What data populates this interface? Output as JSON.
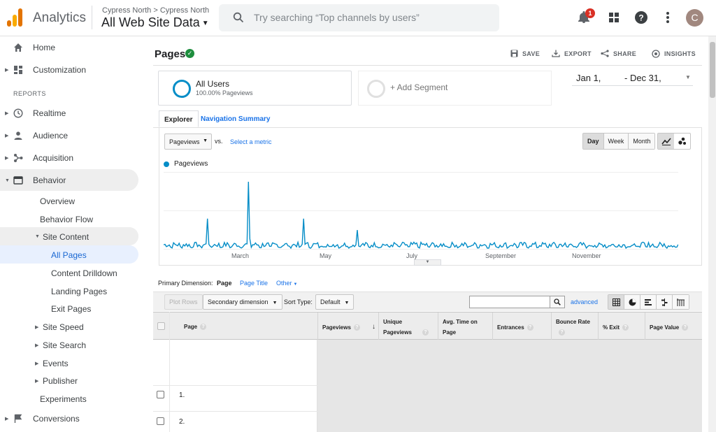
{
  "app": {
    "name": "Analytics",
    "account_path": "Cypress North > Cypress North",
    "view": "All Web Site Data",
    "search_placeholder": "Try searching “Top channels by users”",
    "notification_count": "1",
    "avatar_initial": "C",
    "brand_colors": {
      "orange_dark": "#e37400",
      "orange_light": "#f9ab00",
      "accent": "#058dc7"
    }
  },
  "sidebar": {
    "home": "Home",
    "customization": "Customization",
    "reports_header": "REPORTS",
    "realtime": "Realtime",
    "audience": "Audience",
    "acquisition": "Acquisition",
    "behavior": "Behavior",
    "behavior_items": {
      "overview": "Overview",
      "behavior_flow": "Behavior Flow",
      "site_content": "Site Content",
      "all_pages": "All Pages",
      "content_drilldown": "Content Drilldown",
      "landing_pages": "Landing Pages",
      "exit_pages": "Exit Pages",
      "site_speed": "Site Speed",
      "site_search": "Site Search",
      "events": "Events",
      "publisher": "Publisher",
      "experiments": "Experiments"
    },
    "conversions": "Conversions"
  },
  "page": {
    "title": "Pages",
    "actions": {
      "save": "SAVE",
      "export": "EXPORT",
      "share": "SHARE",
      "insights": "INSIGHTS"
    },
    "segment": {
      "name": "All Users",
      "sub": "100.00% Pageviews"
    },
    "add_segment": "+ Add Segment",
    "date_range": {
      "start": "Jan 1,",
      "end": "- Dec 31,"
    },
    "tabs": {
      "explorer": "Explorer",
      "navigation_summary": "Navigation Summary"
    },
    "metric_select": "Pageviews",
    "vs": "vs.",
    "select_metric": "Select a metric",
    "granularity": {
      "day": "Day",
      "week": "Week",
      "month": "Month",
      "selected": "Day"
    },
    "primary_dimension": {
      "label": "Primary Dimension:",
      "page": "Page",
      "page_title": "Page Title",
      "other": "Other"
    },
    "toolbar": {
      "plot_rows": "Plot Rows",
      "secondary_dimension": "Secondary dimension",
      "sort_type_label": "Sort Type:",
      "sort_type_value": "Default",
      "advanced": "advanced"
    },
    "table": {
      "columns": [
        "Page",
        "Pageviews",
        "Unique Pageviews",
        "Avg. Time on Page",
        "Entrances",
        "Bounce Rate",
        "% Exit",
        "Page Value"
      ],
      "rows": [
        {
          "num": "1."
        },
        {
          "num": "2."
        }
      ]
    }
  },
  "chart_data": {
    "type": "line",
    "series": [
      {
        "name": "Pageviews",
        "color": "#058dc7"
      }
    ],
    "x_tick_labels": [
      "March",
      "May",
      "July",
      "September",
      "November"
    ],
    "grid": true,
    "legend": "top-left",
    "spikes": [
      {
        "near": "February",
        "rel": 0.45
      },
      {
        "near": "March",
        "rel": 1.0
      },
      {
        "near": "April",
        "rel": 0.45
      },
      {
        "near": "May",
        "rel": 0.28
      }
    ],
    "baseline_rel": 0.1
  }
}
